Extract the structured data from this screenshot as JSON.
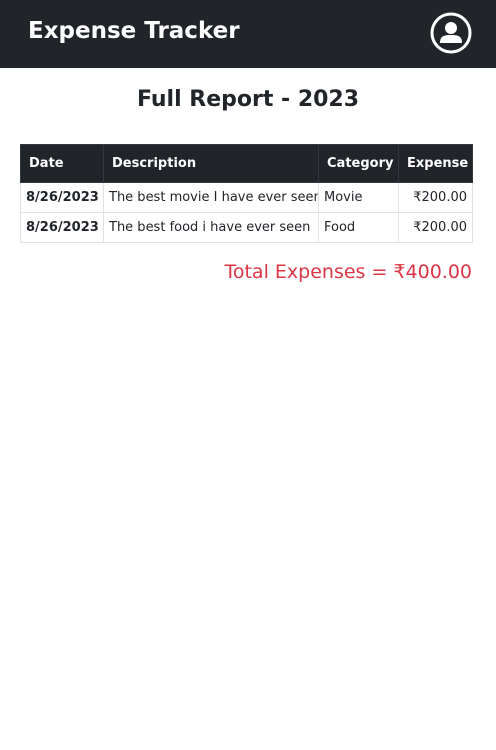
{
  "navbar": {
    "brand": "Expense Tracker",
    "profile_icon": "user-circle-icon"
  },
  "report": {
    "title": "Full Report - 2023",
    "columns": [
      "Date",
      "Description",
      "Category",
      "Expense"
    ],
    "rows": [
      {
        "date": "8/26/2023",
        "description": "The best movie I have ever seen",
        "category": "Movie",
        "expense": "₹200.00"
      },
      {
        "date": "8/26/2023",
        "description": "The best food i have ever seen",
        "category": "Food",
        "expense": "₹200.00"
      }
    ],
    "total_label": "Total Expenses = ₹400.00"
  },
  "colors": {
    "navbar_bg": "#212529",
    "total_text": "#dc3545"
  }
}
